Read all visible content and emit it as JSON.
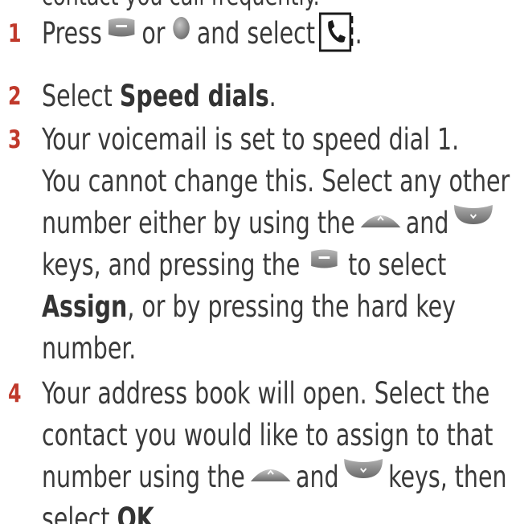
{
  "intro_fragment": "contact you call frequently.",
  "steps": [
    {
      "number": "1",
      "parts": {
        "a": "Press",
        "b": "or",
        "c": "and select",
        "d": "."
      }
    },
    {
      "number": "2",
      "parts": {
        "a": "Select ",
        "bold": "Speed dials",
        "b": "."
      }
    },
    {
      "number": "3",
      "lines": {
        "l1": "Your voicemail is set to speed dial 1.",
        "l2": "You cannot change this. Select any other",
        "l3a": "number either by using the",
        "l3b": "and",
        "l4a": "keys, and pressing the",
        "l4b": "to select",
        "l5bold": "Assign",
        "l5": ", or by pressing the hard key",
        "l6": "number."
      }
    },
    {
      "number": "4",
      "lines": {
        "l1": "Your address book will open. Select the",
        "l2": "contact you would like to assign to that",
        "l3a": "number using the",
        "l3b": "and",
        "l3c": "keys, then",
        "l4a": "select ",
        "l4bold": "OK",
        "l4b": "."
      }
    }
  ],
  "icons": {
    "softkey": "left-soft-key-icon",
    "center": "center-ok-key-icon",
    "phonebook": "contacts-phonebook-icon",
    "up": "navigation-up-key-icon",
    "down": "navigation-down-key-icon"
  },
  "colors": {
    "text": "#3a3a3a",
    "step_number": "#c0392b",
    "key_grey": "#8a8a8a"
  }
}
